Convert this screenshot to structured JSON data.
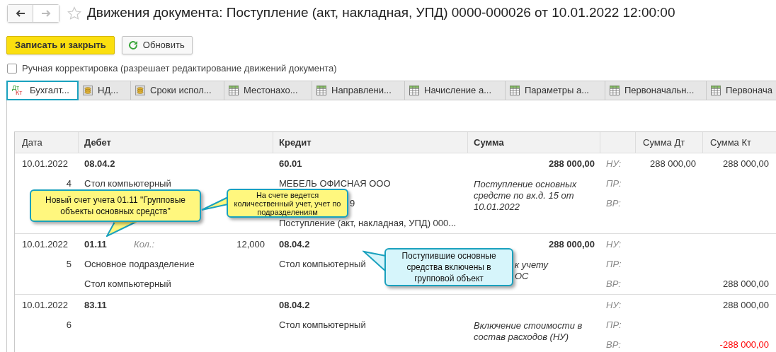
{
  "window": {
    "title": "Движения документа: Поступление (акт, накладная, УПД) 0000-000026 от 10.01.2022 12:00:00",
    "starred": false
  },
  "toolbar": {
    "save_button": "Записать и закрыть",
    "refresh_button": "Обновить"
  },
  "manual_edit": {
    "label": "Ручная корректировка (разрешает редактирование движений документа)",
    "checked": false
  },
  "tabs": [
    {
      "label": "Бухгалт...",
      "kind": "dtkt",
      "icon_text": [
        "Дт",
        "Кт"
      ],
      "selected": true
    },
    {
      "label": "НД...",
      "kind": "coins",
      "selected": false
    },
    {
      "label": "Сроки испол...",
      "kind": "coins",
      "selected": false
    },
    {
      "label": "Местонахо...",
      "kind": "table",
      "selected": false
    },
    {
      "label": "Направлени...",
      "kind": "table",
      "selected": false
    },
    {
      "label": "Начисление а...",
      "kind": "table",
      "selected": false
    },
    {
      "label": "Параметры а...",
      "kind": "table",
      "selected": false
    },
    {
      "label": "Первоначальн...",
      "kind": "table",
      "selected": false
    },
    {
      "label": "Первонача",
      "kind": "table",
      "selected": false
    }
  ],
  "table": {
    "columns": [
      "Дата",
      "Дебет",
      "Кредит",
      "Сумма",
      "Сумма Дт",
      "Сумма Кт"
    ],
    "rows": [
      {
        "date": "10.01.2022",
        "number": "4",
        "debit": {
          "account": "08.04.2",
          "lines": [
            "Стол компьютерный"
          ]
        },
        "credit": {
          "account": "60.01",
          "lines": [
            "МЕБЕЛЬ ОФИСНАЯ ООО",
            "9",
            "Поступление (акт, накладная, УПД) 000..."
          ]
        },
        "sum": {
          "amount": "288 000,00",
          "description": [
            "Поступление основных",
            "средсте по вх.д. 15 от",
            "10.01.2022"
          ]
        },
        "registers": [
          {
            "label": "НУ:",
            "dt": "288 000,00",
            "kt": {
              "value": "288 000,00",
              "negative": false
            }
          },
          {
            "label": "ПР:"
          },
          {
            "label": "ВР:"
          }
        ]
      },
      {
        "date": "10.01.2022",
        "number": "5",
        "debit": {
          "account": "01.11",
          "qty_label": "Кол.:",
          "qty": "12,000",
          "lines": [
            "Основное подразделение",
            "Стол компьютерный"
          ]
        },
        "credit": {
          "account": "08.04.2",
          "lines": [
            "Стол компьютерный"
          ]
        },
        "sum": {
          "amount": "288 000,00",
          "description": [
            "к учету",
            "ОС"
          ]
        },
        "registers": [
          {
            "label": "НУ:"
          },
          {
            "label": "ПР:"
          },
          {
            "label": "ВР:",
            "kt": {
              "value": "288 000,00",
              "negative": false
            }
          }
        ]
      },
      {
        "date": "10.01.2022",
        "number": "6",
        "debit": {
          "account": "83.11"
        },
        "credit": {
          "account": "08.04.2",
          "lines": [
            "Стол компьютерный"
          ]
        },
        "sum": {
          "description": [
            "Включение стоимости в",
            "состав расходов (НУ)"
          ]
        },
        "registers": [
          {
            "label": "НУ:",
            "kt": {
              "value": "288 000,00",
              "negative": false
            }
          },
          {
            "label": "ПР:"
          },
          {
            "label": "ВР:",
            "kt": {
              "value": "-288 000,00",
              "negative": true
            }
          }
        ]
      }
    ]
  },
  "callouts": [
    {
      "text": "Новый счет учета 01.11 \"Групповые объекты основных средств\"",
      "color": "#fff77e"
    },
    {
      "text": "На счете ведется количественный учет, учет по подразделениям",
      "color": "#fff77e"
    },
    {
      "text": "Поступившие основные средства включены в групповой объект",
      "color": "#d6f5fb"
    }
  ]
}
